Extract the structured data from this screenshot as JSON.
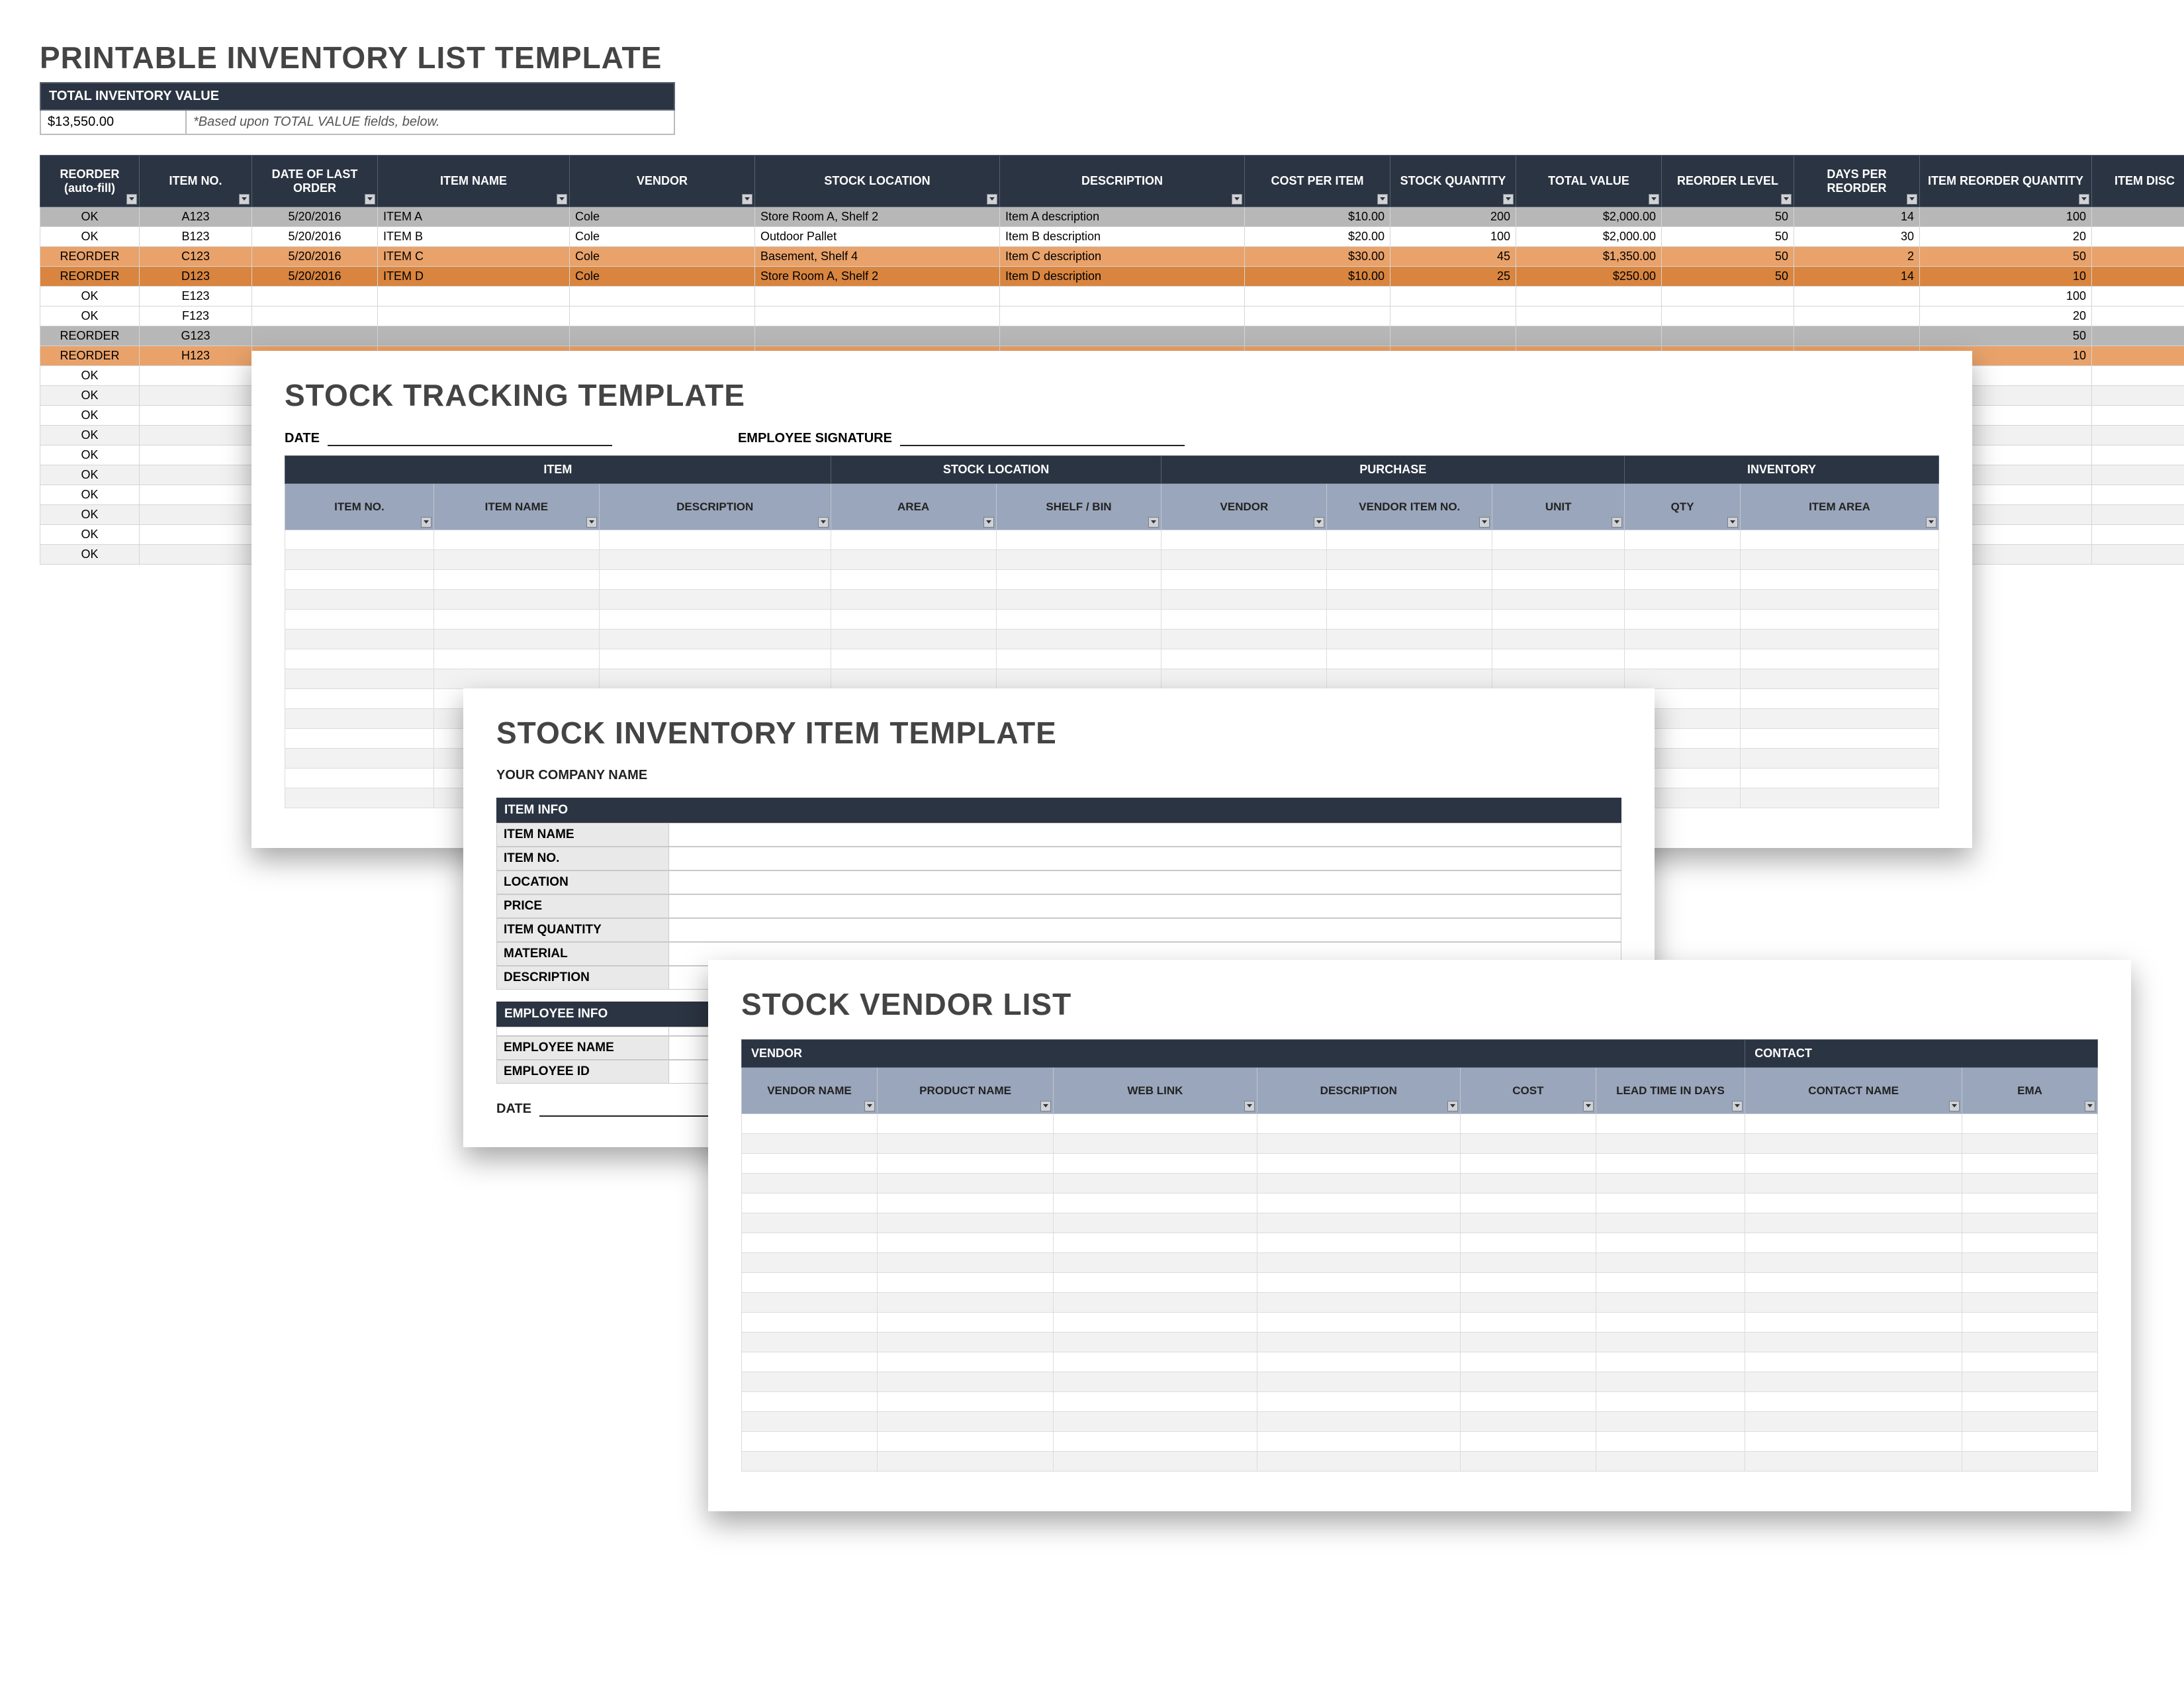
{
  "sheet1": {
    "title": "PRINTABLE INVENTORY LIST TEMPLATE",
    "total_inv_label": "TOTAL INVENTORY VALUE",
    "total_inv_value": "$13,550.00",
    "total_inv_note": "*Based upon TOTAL VALUE fields, below.",
    "columns": [
      "REORDER (auto-fill)",
      "ITEM NO.",
      "DATE OF LAST ORDER",
      "ITEM NAME",
      "VENDOR",
      "STOCK LOCATION",
      "DESCRIPTION",
      "COST PER ITEM",
      "STOCK QUANTITY",
      "TOTAL VALUE",
      "REORDER LEVEL",
      "DAYS PER REORDER",
      "ITEM REORDER QUANTITY",
      "ITEM DISC"
    ],
    "rows": [
      {
        "cls": "row-gray",
        "reorder": "OK",
        "no": "A123",
        "date": "5/20/2016",
        "name": "ITEM A",
        "vendor": "Cole",
        "loc": "Store Room A, Shelf 2",
        "desc": "Item A description",
        "cost": "$10.00",
        "qty": "200",
        "total": "$2,000.00",
        "rl": "50",
        "days": "14",
        "rq": "100"
      },
      {
        "cls": "row-ok",
        "reorder": "OK",
        "no": "B123",
        "date": "5/20/2016",
        "name": "ITEM B",
        "vendor": "Cole",
        "loc": "Outdoor Pallet",
        "desc": "Item B description",
        "cost": "$20.00",
        "qty": "100",
        "total": "$2,000.00",
        "rl": "50",
        "days": "30",
        "rq": "20"
      },
      {
        "cls": "row-reorder",
        "reorder": "REORDER",
        "no": "C123",
        "date": "5/20/2016",
        "name": "ITEM C",
        "vendor": "Cole",
        "loc": "Basement, Shelf 4",
        "desc": "Item C description",
        "cost": "$30.00",
        "qty": "45",
        "total": "$1,350.00",
        "rl": "50",
        "days": "2",
        "rq": "50"
      },
      {
        "cls": "row-reorder-dark",
        "reorder": "REORDER",
        "no": "D123",
        "date": "5/20/2016",
        "name": "ITEM D",
        "vendor": "Cole",
        "loc": "Store Room A, Shelf 2",
        "desc": "Item D description",
        "cost": "$10.00",
        "qty": "25",
        "total": "$250.00",
        "rl": "50",
        "days": "14",
        "rq": "10"
      },
      {
        "cls": "row-ok",
        "reorder": "OK",
        "no": "E123",
        "rq": "100"
      },
      {
        "cls": "row-ok",
        "reorder": "OK",
        "no": "F123",
        "rq": "20"
      },
      {
        "cls": "row-gray",
        "reorder": "REORDER",
        "no": "G123",
        "rq": "50"
      },
      {
        "cls": "row-reorder",
        "reorder": "REORDER",
        "no": "H123",
        "rq": "10"
      },
      {
        "cls": "row-ok",
        "reorder": "OK"
      },
      {
        "cls": "row-ok-alt",
        "reorder": "OK"
      },
      {
        "cls": "row-ok",
        "reorder": "OK"
      },
      {
        "cls": "row-ok-alt",
        "reorder": "OK"
      },
      {
        "cls": "row-ok",
        "reorder": "OK"
      },
      {
        "cls": "row-ok-alt",
        "reorder": "OK"
      },
      {
        "cls": "row-ok",
        "reorder": "OK"
      },
      {
        "cls": "row-ok-alt",
        "reorder": "OK"
      },
      {
        "cls": "row-ok",
        "reorder": "OK"
      },
      {
        "cls": "row-ok-alt",
        "reorder": "OK"
      }
    ]
  },
  "sheet2": {
    "title": "STOCK TRACKING TEMPLATE",
    "date_label": "DATE",
    "sig_label": "EMPLOYEE SIGNATURE",
    "groups": [
      "ITEM",
      "STOCK LOCATION",
      "PURCHASE",
      "INVENTORY"
    ],
    "columns": [
      "ITEM NO.",
      "ITEM NAME",
      "DESCRIPTION",
      "AREA",
      "SHELF / BIN",
      "VENDOR",
      "VENDOR ITEM NO.",
      "UNIT",
      "QTY",
      "ITEM AREA"
    ],
    "blank_rows": 14
  },
  "sheet3": {
    "title": "STOCK INVENTORY ITEM TEMPLATE",
    "company_label": "YOUR COMPANY NAME",
    "item_info_label": "ITEM INFO",
    "item_fields": [
      "ITEM NAME",
      "ITEM NO.",
      "LOCATION",
      "PRICE",
      "ITEM QUANTITY",
      "MATERIAL",
      "DESCRIPTION"
    ],
    "emp_info_label": "EMPLOYEE INFO",
    "emp_fields": [
      "EMPLOYEE NAME",
      "EMPLOYEE ID"
    ],
    "date_label": "DATE"
  },
  "sheet4": {
    "title": "STOCK VENDOR LIST",
    "groups": [
      "VENDOR",
      "CONTACT"
    ],
    "columns": [
      "VENDOR NAME",
      "PRODUCT NAME",
      "WEB LINK",
      "DESCRIPTION",
      "COST",
      "LEAD TIME IN DAYS",
      "CONTACT NAME",
      "EMA"
    ],
    "blank_rows": 18
  }
}
